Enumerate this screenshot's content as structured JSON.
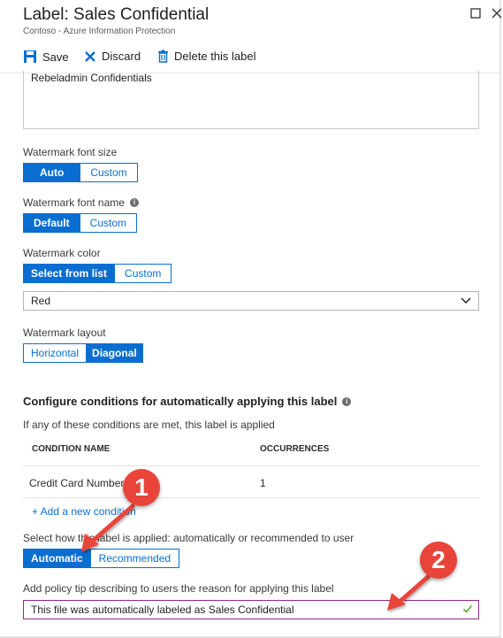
{
  "header": {
    "title": "Label: Sales Confidential",
    "subtitle": "Contoso - Azure Information Protection"
  },
  "toolbar": {
    "save_label": "Save",
    "discard_label": "Discard",
    "delete_label": "Delete this label"
  },
  "watermark_text": {
    "value": "Rebeladmin Confidentials"
  },
  "font_size": {
    "label": "Watermark font size",
    "options": [
      "Auto",
      "Custom"
    ],
    "selected": "Auto"
  },
  "font_name": {
    "label": "Watermark font name",
    "options": [
      "Default",
      "Custom"
    ],
    "selected": "Default"
  },
  "color": {
    "label": "Watermark color",
    "options": [
      "Select from list",
      "Custom"
    ],
    "selected": "Select from list",
    "dropdown_value": "Red"
  },
  "layout": {
    "label": "Watermark layout",
    "options": [
      "Horizontal",
      "Diagonal"
    ],
    "selected": "Diagonal"
  },
  "conditions": {
    "title": "Configure conditions for automatically applying this label",
    "description": "If any of these conditions are met, this label is applied",
    "columns": [
      "CONDITION NAME",
      "OCCURRENCES"
    ],
    "rows": [
      {
        "name": "Credit Card Number",
        "occurrences": "1"
      }
    ],
    "add_link": "+ Add a new condition"
  },
  "apply_mode": {
    "label": "Select how this label is applied: automatically or recommended to user",
    "options": [
      "Automatic",
      "Recommended"
    ],
    "selected": "Automatic"
  },
  "policy_tip": {
    "label": "Add policy tip describing to users the reason for applying this label",
    "value": "This file was automatically labeled as Sales Confidential"
  },
  "callouts": [
    "1",
    "2"
  ],
  "colors": {
    "accent": "#0a6ed1",
    "callout": "#e8443a",
    "tip_border": "#8a2b8a",
    "check": "#5aa832"
  }
}
